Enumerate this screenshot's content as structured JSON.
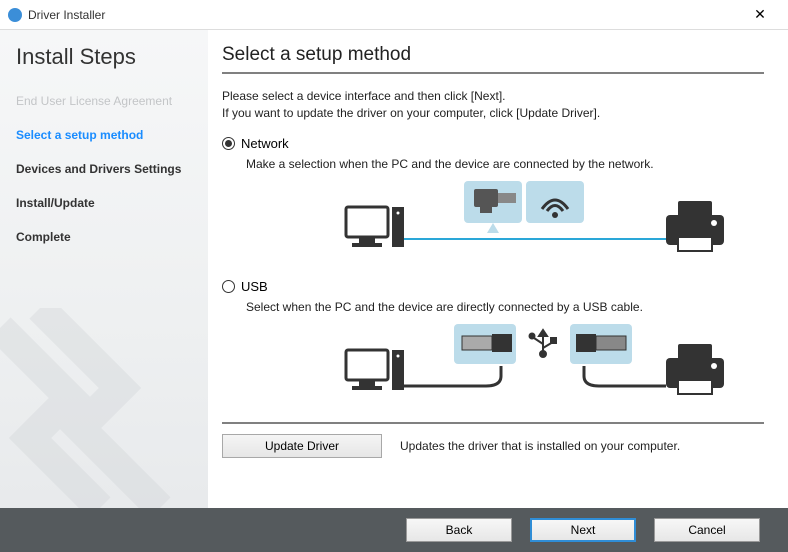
{
  "window": {
    "title": "Driver Installer"
  },
  "sidebar": {
    "heading": "Install Steps",
    "steps": [
      {
        "label": "End User License Agreement",
        "state": "done"
      },
      {
        "label": "Select a setup method",
        "state": "current"
      },
      {
        "label": "Devices and Drivers Settings",
        "state": "future"
      },
      {
        "label": "Install/Update",
        "state": "future"
      },
      {
        "label": "Complete",
        "state": "future"
      }
    ]
  },
  "main": {
    "heading": "Select a setup method",
    "intro_line1": "Please select a device interface and then click [Next].",
    "intro_line2": "If you want to update the driver on your computer, click [Update Driver].",
    "options": {
      "network": {
        "label": "Network",
        "checked": true,
        "description": "Make a selection when the PC and the device are connected by the network."
      },
      "usb": {
        "label": "USB",
        "checked": false,
        "description": "Select when the PC and the device are directly connected by a USB cable."
      }
    },
    "update": {
      "button": "Update Driver",
      "description": "Updates the driver that is installed on your computer."
    }
  },
  "footer": {
    "back": "Back",
    "next": "Next",
    "cancel": "Cancel"
  }
}
